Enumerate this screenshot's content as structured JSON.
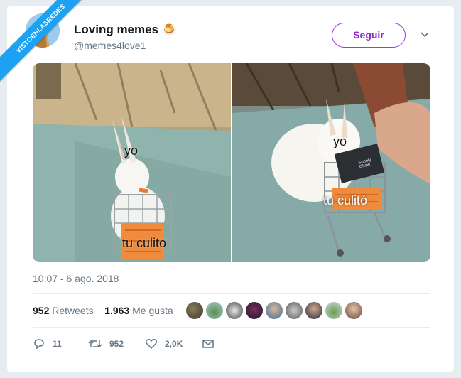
{
  "watermark": "VISTOENLASREDES",
  "tweet": {
    "display_name": "Loving memes",
    "emoji": "🍮",
    "handle": "@memes4love1",
    "follow_label": "Seguir",
    "timestamp": "10:07 - 6 ago. 2018",
    "retweets_count": "952",
    "retweets_label": "Retweets",
    "likes_count": "1.963",
    "likes_label": "Me gusta"
  },
  "media": {
    "left_panel": {
      "caption_top": "yo",
      "caption_bottom": "tu culito"
    },
    "right_panel": {
      "caption_top": "yo",
      "caption_bottom": "tu culitó",
      "box_text": "Supply Chain"
    }
  },
  "actions": {
    "reply_count": "11",
    "retweet_count": "952",
    "like_count": "2,0K"
  },
  "colors": {
    "brand_blue": "#1da1f2",
    "follow_purple": "#8d2bd0",
    "text_secondary": "#657786"
  },
  "likers": [
    "liker-1",
    "liker-2",
    "liker-3",
    "liker-4",
    "liker-5",
    "liker-6",
    "liker-7",
    "liker-8",
    "liker-9"
  ]
}
